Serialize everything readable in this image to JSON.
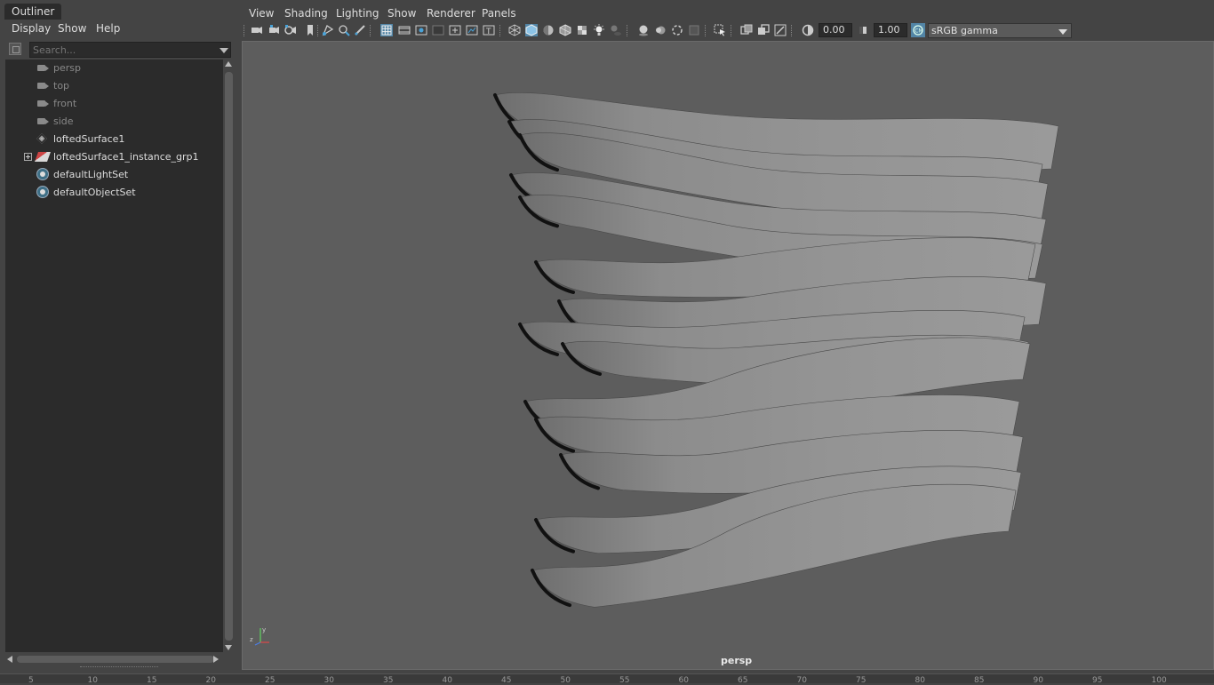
{
  "outliner": {
    "tab_title": "Outliner",
    "menu": [
      "Display",
      "Show",
      "Help"
    ],
    "search_placeholder": "Search...",
    "items": [
      {
        "label": "persp",
        "icon": "camera-icon",
        "dim": true
      },
      {
        "label": "top",
        "icon": "camera-icon",
        "dim": true
      },
      {
        "label": "front",
        "icon": "camera-icon",
        "dim": true
      },
      {
        "label": "side",
        "icon": "camera-icon",
        "dim": true
      },
      {
        "label": "loftedSurface1",
        "icon": "nurbs-surface-icon",
        "dim": false
      },
      {
        "label": "loftedSurface1_instance_grp1",
        "icon": "group-icon",
        "dim": false,
        "expandable": true
      },
      {
        "label": "defaultLightSet",
        "icon": "set-icon",
        "dim": false
      },
      {
        "label": "defaultObjectSet",
        "icon": "set-icon",
        "dim": false
      }
    ]
  },
  "viewport": {
    "menu": [
      "View",
      "Shading",
      "Lighting",
      "Show",
      "Renderer",
      "Panels"
    ],
    "exposure": "0.00",
    "gamma": "1.00",
    "color_space": "sRGB gamma",
    "camera": "persp"
  },
  "timeline": {
    "ticks": [
      "5",
      "10",
      "15",
      "20",
      "25",
      "30",
      "35",
      "40",
      "45",
      "50",
      "55",
      "60",
      "65",
      "70",
      "75",
      "80",
      "85",
      "90",
      "95",
      "100"
    ]
  },
  "colors": {
    "panel": "#444444",
    "list_bg": "#2b2b2b",
    "viewport_bg": "#5d5d5d",
    "active_toggle": "#5285a6"
  }
}
